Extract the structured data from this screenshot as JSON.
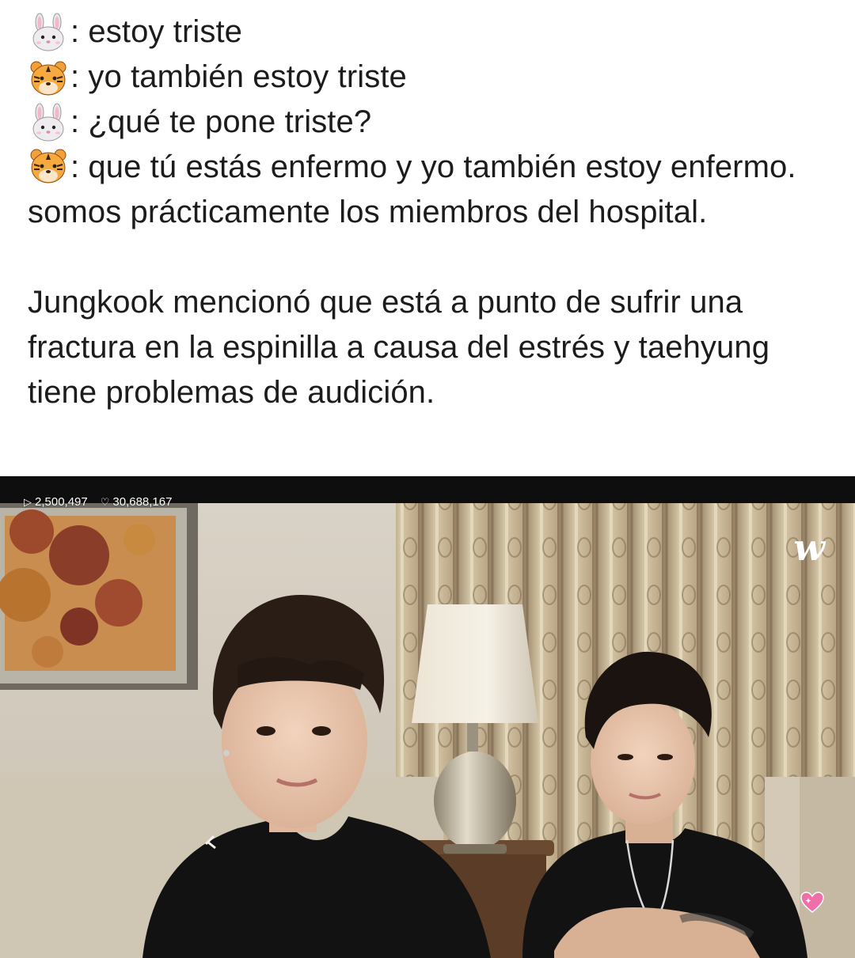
{
  "post": {
    "lines": [
      {
        "speaker_icon": "rabbit-face-icon",
        "text": ": estoy triste"
      },
      {
        "speaker_icon": "tiger-face-icon",
        "text": ": yo también estoy triste"
      },
      {
        "speaker_icon": "rabbit-face-icon",
        "text": ": ¿qué te pone triste?"
      },
      {
        "speaker_icon": "tiger-face-icon",
        "text": ": que tú estás enfermo y yo también estoy enfermo. somos prácticamente los miembros del hospital."
      }
    ],
    "paragraph": "Jungkook mencionó que está a punto de sufrir una fractura en la espinilla a causa del estrés y taehyung tiene problemas de audición."
  },
  "video": {
    "views": "2,500,497",
    "likes": "30,688,167",
    "views_icon": "play-icon",
    "likes_icon": "heart-outline-icon",
    "logo_text": "w",
    "reaction_icon": "sparkle-heart-icon"
  },
  "colors": {
    "text": "#1c1c1c",
    "background": "#ffffff",
    "heart_pink": "#f06fa8"
  }
}
